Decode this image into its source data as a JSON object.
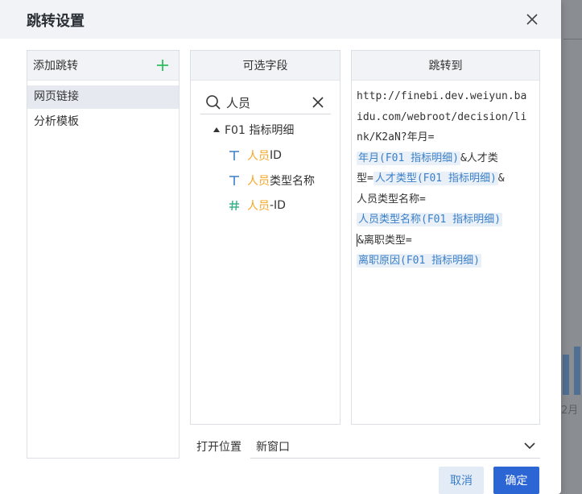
{
  "dialog": {
    "title": "跳转设置",
    "close_icon": "close-icon"
  },
  "left_panel": {
    "header": "添加跳转",
    "add_icon": "plus-icon",
    "accent": "#2dbf5f",
    "items": [
      {
        "label": "网页链接",
        "active": true
      },
      {
        "label": "分析模板",
        "active": false
      }
    ]
  },
  "middle_panel": {
    "header": "可选字段",
    "search": {
      "value": "人员",
      "icon": "search-icon",
      "clear_icon": "close-icon"
    },
    "group": {
      "label": "F01 指标明细",
      "icon": "caret-up-icon"
    },
    "fields": [
      {
        "icon": "text-type-icon",
        "match": "人员",
        "rest": "ID"
      },
      {
        "icon": "text-type-icon",
        "match": "人员",
        "rest": "类型名称"
      },
      {
        "icon": "number-type-icon",
        "match": "人员",
        "rest": "-ID"
      }
    ],
    "highlight_color": "#f5a623",
    "number_icon_color": "#3bb38a",
    "text_icon_color": "#3b7fc8"
  },
  "right_panel": {
    "header": "跳转到",
    "url_lines": [
      "http://finebi.dev.weiyun.ba",
      "idu.com/webroot/decision/li",
      "nk/K2aN?年月="
    ],
    "chips": [
      {
        "label": "年月(F01 指标明细)",
        "after": "&人才类"
      },
      {
        "before": "型=",
        "label": "人才类型(F01 指标明细)",
        "after": "&"
      },
      {
        "before": "人员类型名称=",
        "label": "人员类型名称(F01 指标明细)",
        "after": ""
      },
      {
        "before": "&离职类型=",
        "label": "离职原因(F01 指标明细)",
        "after": ""
      }
    ],
    "chip_color": "#3b7fc8",
    "chip_bg": "#e9f0f8"
  },
  "open_position": {
    "label": "打开位置",
    "value": "新窗口",
    "icon": "chevron-down-icon"
  },
  "buttons": {
    "cancel": "取消",
    "ok": "确定",
    "ok_color": "#2c66d4"
  },
  "background": {
    "month_label": "2月"
  }
}
